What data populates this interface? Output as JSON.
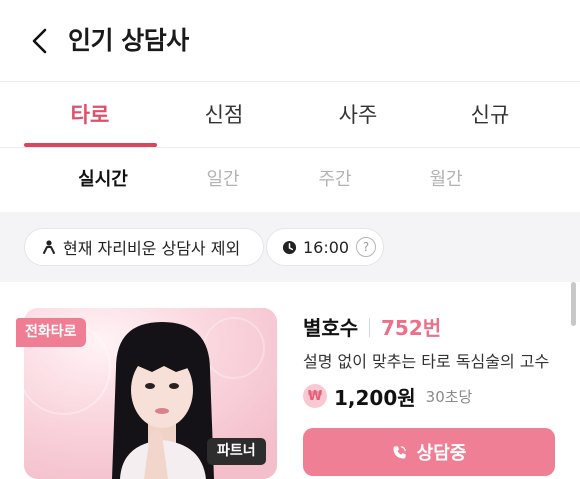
{
  "header": {
    "title": "인기 상담사",
    "back_icon": "chevron-left-icon"
  },
  "tabs": [
    {
      "label": "타로",
      "active": true
    },
    {
      "label": "신점",
      "active": false
    },
    {
      "label": "사주",
      "active": false
    },
    {
      "label": "신규",
      "active": false
    }
  ],
  "periods": [
    {
      "label": "실시간",
      "active": true
    },
    {
      "label": "일간",
      "active": false
    },
    {
      "label": "주간",
      "active": false
    },
    {
      "label": "월간",
      "active": false
    }
  ],
  "filters": {
    "exclude_away": {
      "label": "현재 자리비운 상담사 제외",
      "icon": "away-person-icon"
    },
    "time": {
      "label": "16:00",
      "icon": "clock-icon",
      "help": "?"
    }
  },
  "counselor": {
    "badge": "전화타로",
    "partner_badge": "파트너",
    "name": "별호수",
    "number": "752번",
    "description": "설명 없이 맞추는 타로 독심술의 고수",
    "currency_symbol": "₩",
    "price": "1,200원",
    "price_unit": "30초당",
    "button_label": "상담중",
    "button_icon": "phone-icon"
  },
  "colors": {
    "accent": "#e0506b",
    "button": "#ef7f95",
    "badge": "#ef7d93",
    "partner": "#2d2d2d"
  }
}
